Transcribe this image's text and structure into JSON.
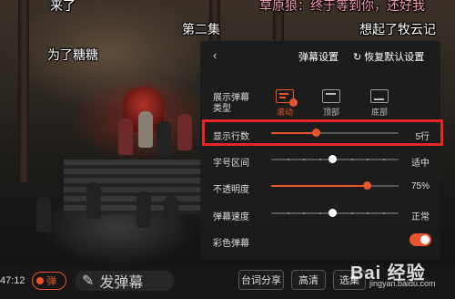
{
  "danmu_overlay": [
    {
      "text": "来了",
      "color": "#ffffff"
    },
    {
      "text": "草原狼：终于等到你，还好我",
      "color": "#f29ab0"
    },
    {
      "text": "第二集",
      "color": "#ffffff"
    },
    {
      "text": "想起了牧云记",
      "color": "#ffffff"
    },
    {
      "text": "为了糖糖",
      "color": "#ffffff"
    }
  ],
  "panel": {
    "title": "弹幕设置",
    "back_icon": "chevron-left-icon",
    "reset_icon": "refresh-icon",
    "reset_label": "恢复默认设置",
    "type_label": "展示弹幕类型",
    "type_options": [
      {
        "label": "滚动",
        "selected": true
      },
      {
        "label": "顶部",
        "selected": false
      },
      {
        "label": "底部",
        "selected": false
      }
    ],
    "rows": [
      {
        "label": "显示行数",
        "value": "5行",
        "level": 0.35
      },
      {
        "label": "字号区间",
        "value": "适中",
        "level": 0.48
      },
      {
        "label": "不透明度",
        "value": "75%",
        "level": 0.75
      },
      {
        "label": "弹幕速度",
        "value": "正常",
        "level": 0.48
      }
    ],
    "color_danmu_label": "彩色弹幕",
    "color_danmu_on": true
  },
  "controlbar": {
    "time": "47:12",
    "danmu_toggle_label": "弹",
    "send_icon": "pen-icon",
    "send_label": "发弹幕",
    "lyrics_share": "台词分享",
    "quality": "高清",
    "speed_partial": "选集"
  },
  "watermark": {
    "brand": "Bai 经验",
    "url": "jingyan.baidu.com"
  },
  "colors": {
    "accent": "#e8542d",
    "highlight": "#e8262a",
    "panel_bg": "#1c1c1c"
  }
}
